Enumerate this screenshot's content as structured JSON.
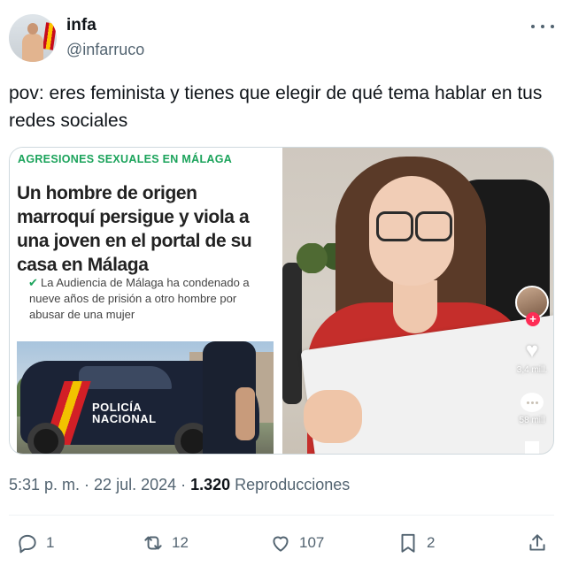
{
  "author": {
    "name": "infa",
    "handle": "@infarruco",
    "avatar_icon": "avatar-photo"
  },
  "more_icon": "more-horizontal-icon",
  "tweet": {
    "text": "pov: eres feminista y tienes que elegir de qué tema hablar en tus redes sociales"
  },
  "media": {
    "news": {
      "kicker": "AGRESIONES SEXUALES EN MÁLAGA",
      "headline": "Un hombre de origen marroquí persigue y viola a una joven en el portal de su casa en Málaga",
      "check_icon": "✔",
      "subhead": "La Audiencia de Málaga ha condenado a nueve años de prisión a otro hombre por abusar de una mujer",
      "car_text_line1": "POLICÍA",
      "car_text_line2": "NACIONAL"
    },
    "video": {
      "likes": "3,4 mill.",
      "comments": "58 mill",
      "plus_icon": "+",
      "accent_color": "#fe2c55"
    }
  },
  "meta": {
    "time": "5:31 p. m.",
    "sep1": " · ",
    "date": "22 jul. 2024",
    "sep2": " · ",
    "views": "1.320",
    "views_label": " Reproducciones"
  },
  "actions": {
    "replies": "1",
    "retweets": "12",
    "likes": "107",
    "bookmarks": "2"
  },
  "colors": {
    "text": "#0f1419",
    "secondary": "#536471",
    "news_green": "#1ba35b"
  }
}
